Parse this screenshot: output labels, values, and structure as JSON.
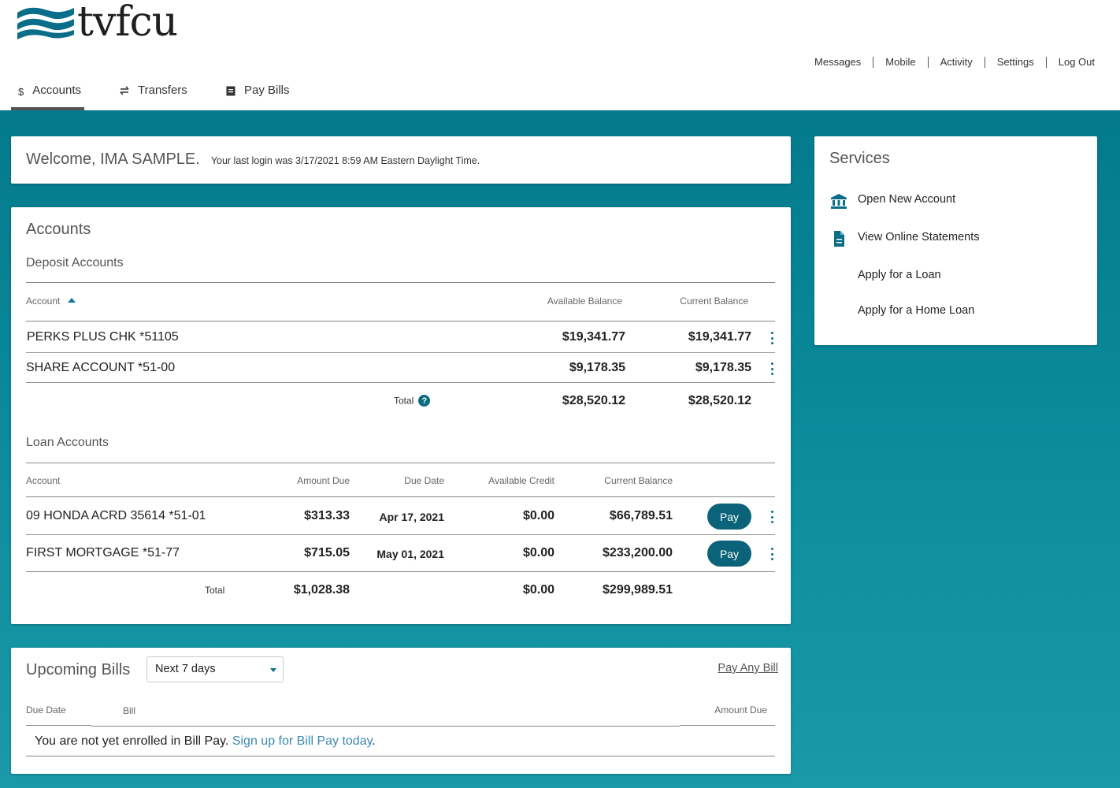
{
  "brand": {
    "name": "tvfcu",
    "wave_color": "#0a6e8a"
  },
  "util_nav": [
    "Messages",
    "Mobile",
    "Activity",
    "Settings",
    "Log Out"
  ],
  "main_nav": [
    {
      "label": "Accounts",
      "icon": "dollar-icon",
      "active": true
    },
    {
      "label": "Transfers",
      "icon": "transfer-arrows-icon",
      "active": false
    },
    {
      "label": "Pay Bills",
      "icon": "bill-icon",
      "active": false
    }
  ],
  "welcome": {
    "greeting": "Welcome, IMA SAMPLE.",
    "last_login": "Your last login was 3/17/2021 8:59 AM Eastern Daylight Time."
  },
  "accounts": {
    "title": "Accounts",
    "deposit": {
      "title": "Deposit Accounts",
      "headers": {
        "account": "Account",
        "available": "Available Balance",
        "current": "Current Balance"
      },
      "rows": [
        {
          "name": "PERKS PLUS CHK  *51105",
          "available": "$19,341.77",
          "current": "$19,341.77"
        },
        {
          "name": "SHARE ACCOUNT  *51-00",
          "available": "$9,178.35",
          "current": "$9,178.35"
        }
      ],
      "total": {
        "label": "Total",
        "available": "$28,520.12",
        "current": "$28,520.12"
      }
    },
    "loan": {
      "title": "Loan Accounts",
      "headers": {
        "account": "Account",
        "amount_due": "Amount Due",
        "due_date": "Due Date",
        "available_credit": "Available Credit",
        "current": "Current Balance"
      },
      "rows": [
        {
          "name": "09 HONDA ACRD 35614  *51-01",
          "amount_due": "$313.33",
          "due_date": "Apr 17, 2021",
          "available_credit": "$0.00",
          "current": "$66,789.51",
          "pay_label": "Pay"
        },
        {
          "name": "FIRST MORTGAGE  *51-77",
          "amount_due": "$715.05",
          "due_date": "May 01, 2021",
          "available_credit": "$0.00",
          "current": "$233,200.00",
          "pay_label": "Pay"
        }
      ],
      "total": {
        "label": "Total",
        "amount_due": "$1,028.38",
        "available_credit": "$0.00",
        "current": "$299,989.51"
      }
    }
  },
  "services": {
    "title": "Services",
    "items": [
      {
        "label": "Open New Account",
        "icon": "bank-icon"
      },
      {
        "label": "View Online Statements",
        "icon": "document-icon"
      },
      {
        "label": "Apply for a Loan",
        "icon": ""
      },
      {
        "label": "Apply for a Home Loan",
        "icon": ""
      }
    ]
  },
  "bills": {
    "title": "Upcoming Bills",
    "range": "Next 7 days",
    "pay_any": "Pay Any Bill",
    "headers": {
      "due_date": "Due Date",
      "bill": "Bill",
      "amount_due": "Amount Due"
    },
    "enroll_text": "You are not yet enrolled in Bill Pay.",
    "enroll_link": "Sign up for Bill Pay today",
    "enroll_end": "."
  }
}
